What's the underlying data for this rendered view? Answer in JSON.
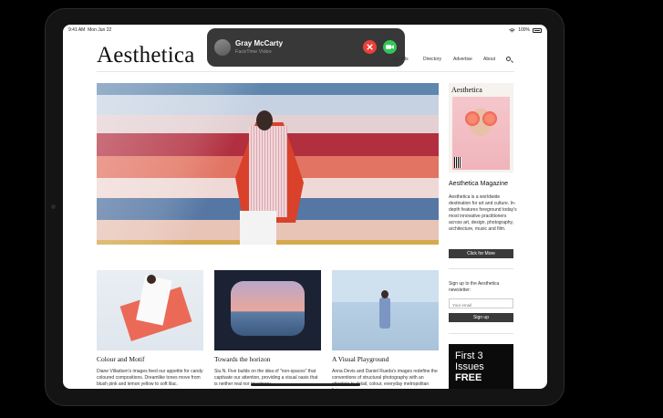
{
  "status_bar": {
    "time": "9:41 AM",
    "date": "Mon Jun 22",
    "battery": "100%",
    "wifi_icon": "wifi-icon"
  },
  "site": {
    "logo": "Aesthetica"
  },
  "nav": {
    "items": [
      {
        "label": "Awards"
      },
      {
        "label": "Directory"
      },
      {
        "label": "Advertise"
      },
      {
        "label": "About"
      }
    ],
    "search_icon": "search-icon"
  },
  "hero": {
    "alt_colors": [
      "#5a7fa8",
      "#c7d3e3",
      "#a8263a",
      "#e07060",
      "#f0d6d4",
      "#4d6f9c",
      "#e9c2b5"
    ]
  },
  "sidebar": {
    "cover_title": "Aesthetica",
    "magazine_title": "Aesthetica Magazine",
    "magazine_text": "Aesthetica is a worldwide destination for art and culture. In-depth features foreground today's most innovative practitioners across art, design, photography, architecture, music and film.",
    "more_button": "Click for More",
    "newsletter_text": "Sign up to the Aesthetica newsletter:",
    "email_placeholder": "Your email",
    "signup_button": "Sign up",
    "promo_line1": "First 3",
    "promo_line2": "Issues",
    "promo_line3": "FREE"
  },
  "cards": [
    {
      "title": "Colour and Motif",
      "text": "Diane Villadsen's images feed our appetite for candy coloured compositions. Dreamlike tones move from blush pink and lemon yellow to soft lilac."
    },
    {
      "title": "Towards the horizon",
      "text": "Siu N. Five builds on the idea of \"non-spaces\" that captivate our attention, providing a visual oasis that is neither real nor imaginary."
    },
    {
      "title": "A Visual Playground",
      "text": "Anna Devis and Daniel Rueda's images redefine the conventions of structural photography with an attention to detail, colour, everyday metropolitan living."
    }
  ],
  "facetime": {
    "name": "Gray McCarty",
    "subtitle": "FaceTime Video",
    "decline_icon": "decline-call-icon",
    "accept_icon": "video-camera-icon"
  }
}
